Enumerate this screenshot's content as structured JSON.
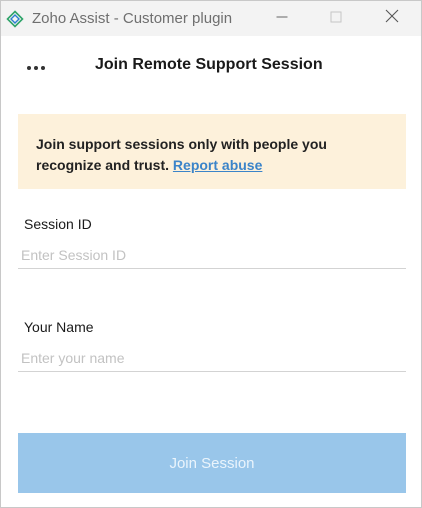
{
  "window": {
    "title": "Zoho Assist - Customer plugin",
    "app_icon": "zoho-assist-icon",
    "controls": [
      "minimize-icon",
      "maximize-icon",
      "close-icon"
    ]
  },
  "header": {
    "menu_icon": "more-horizontal-icon",
    "title": "Join Remote Support Session"
  },
  "notice": {
    "text": "Join support sessions only with people you recognize and trust. ",
    "link_label": "Report abuse",
    "background": "#fdf1db",
    "link_color": "#3b84c9"
  },
  "form": {
    "session_id": {
      "label": "Session ID",
      "value": "",
      "placeholder": "Enter Session ID"
    },
    "name": {
      "label": "Your Name",
      "value": "",
      "placeholder": "Enter your name"
    },
    "submit_label": "Join Session",
    "submit_enabled": false,
    "submit_color": "#99c6ea"
  }
}
